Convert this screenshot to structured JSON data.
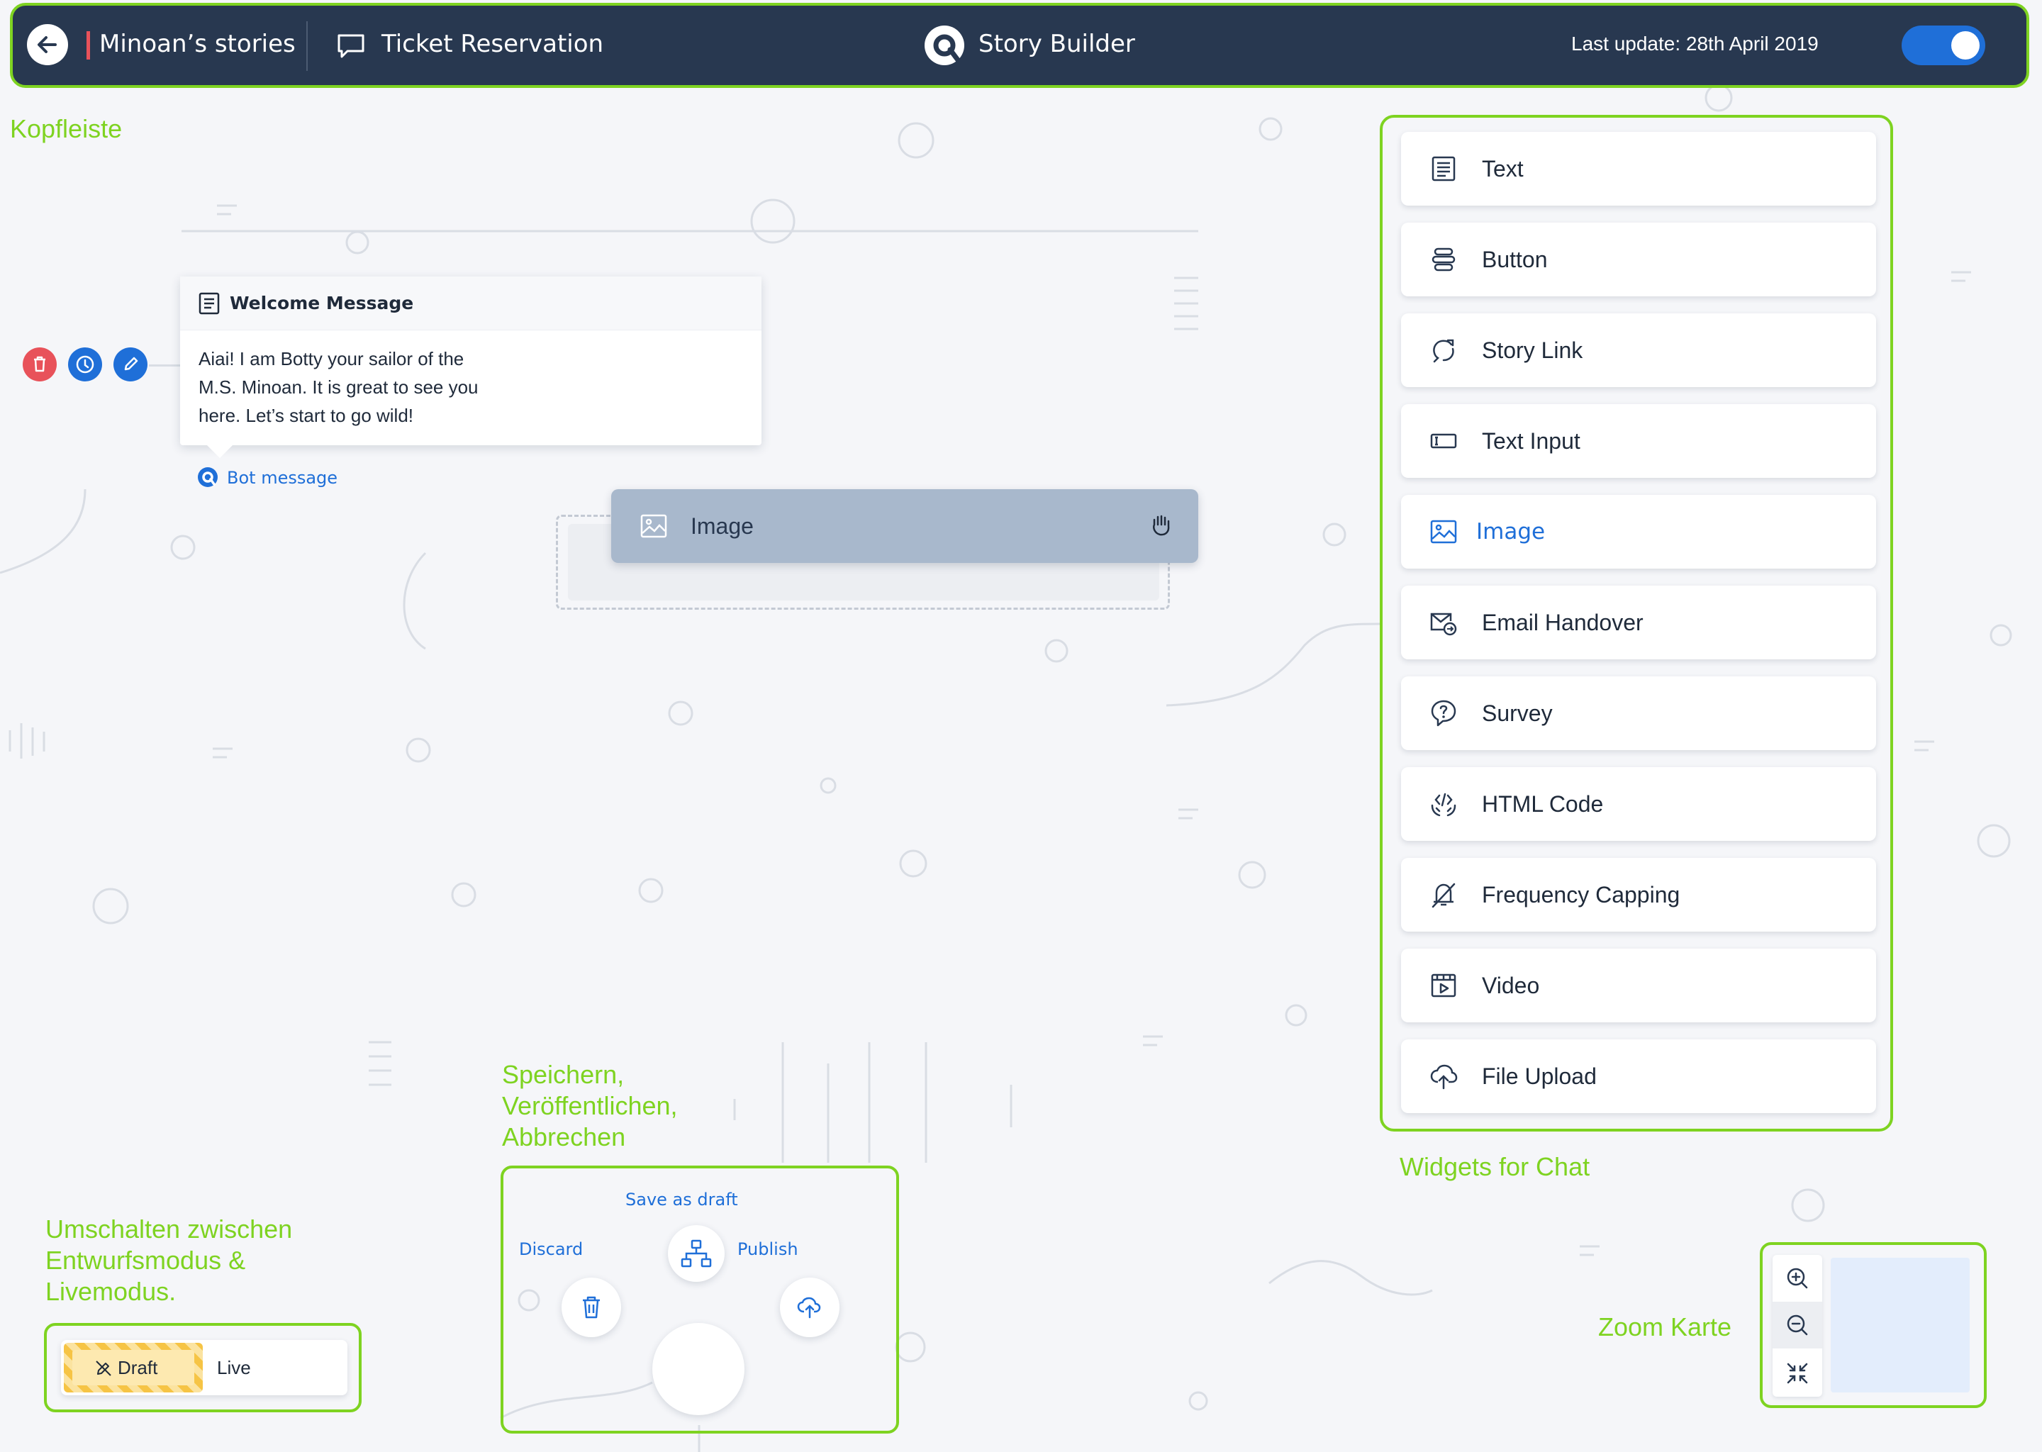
{
  "header": {
    "back_icon": "arrow-left-icon",
    "project_name": "Minoan’s stories",
    "story_icon": "chat-bubble-icon",
    "story_name": "Ticket Reservation",
    "app_logo_icon": "q-logo-icon",
    "app_name": "Story Builder",
    "last_update": "Last update: 28th April 2019",
    "toggle_on": true
  },
  "annotations": {
    "header": "Kopfleiste",
    "actions": [
      "Speichern,",
      "Veröffentlichen,",
      "Abbrechen"
    ],
    "widgets": "Widgets for Chat",
    "mode": [
      "Umschalten zwischen",
      "Entwurfsmodus &",
      "Livemodus."
    ],
    "zoom": "Zoom Karte"
  },
  "widgets": [
    {
      "label": "Text",
      "icon": "text-lines-icon"
    },
    {
      "label": "Button",
      "icon": "button-icon"
    },
    {
      "label": "Story Link",
      "icon": "story-link-icon"
    },
    {
      "label": "Text Input",
      "icon": "text-input-icon"
    },
    {
      "label": "Image",
      "icon": "image-icon",
      "active": true
    },
    {
      "label": "Email Handover",
      "icon": "email-handover-icon"
    },
    {
      "label": "Survey",
      "icon": "survey-icon"
    },
    {
      "label": "HTML Code",
      "icon": "html-code-icon"
    },
    {
      "label": "Frequency Capping",
      "icon": "frequency-capping-icon"
    },
    {
      "label": "Video",
      "icon": "video-icon"
    },
    {
      "label": "File Upload",
      "icon": "file-upload-icon"
    }
  ],
  "canvas": {
    "welcome": {
      "title": "Welcome Message",
      "lines": [
        "Aiai! I am Botty your sailor of the",
        "M.S. Minoan. It is great to see you",
        "here. Let’s start to go wild!"
      ],
      "tag": "Bot message"
    },
    "dragging_widget": "Image",
    "node_actions": [
      "delete-icon",
      "info-icon",
      "edit-icon"
    ]
  },
  "actions": {
    "save_draft": "Save as draft",
    "discard": "Discard",
    "publish": "Publish"
  },
  "mode": {
    "draft": "Draft",
    "live": "Live",
    "selected": "Draft"
  },
  "zoom": {
    "buttons": [
      "zoom-in-icon",
      "zoom-out-icon",
      "fit-screen-icon"
    ]
  },
  "colors": {
    "header_bg": "#283850",
    "accent": "#1f6fd8",
    "annotation": "#7ed321",
    "danger": "#e8525a",
    "draft": "#f6c445"
  }
}
